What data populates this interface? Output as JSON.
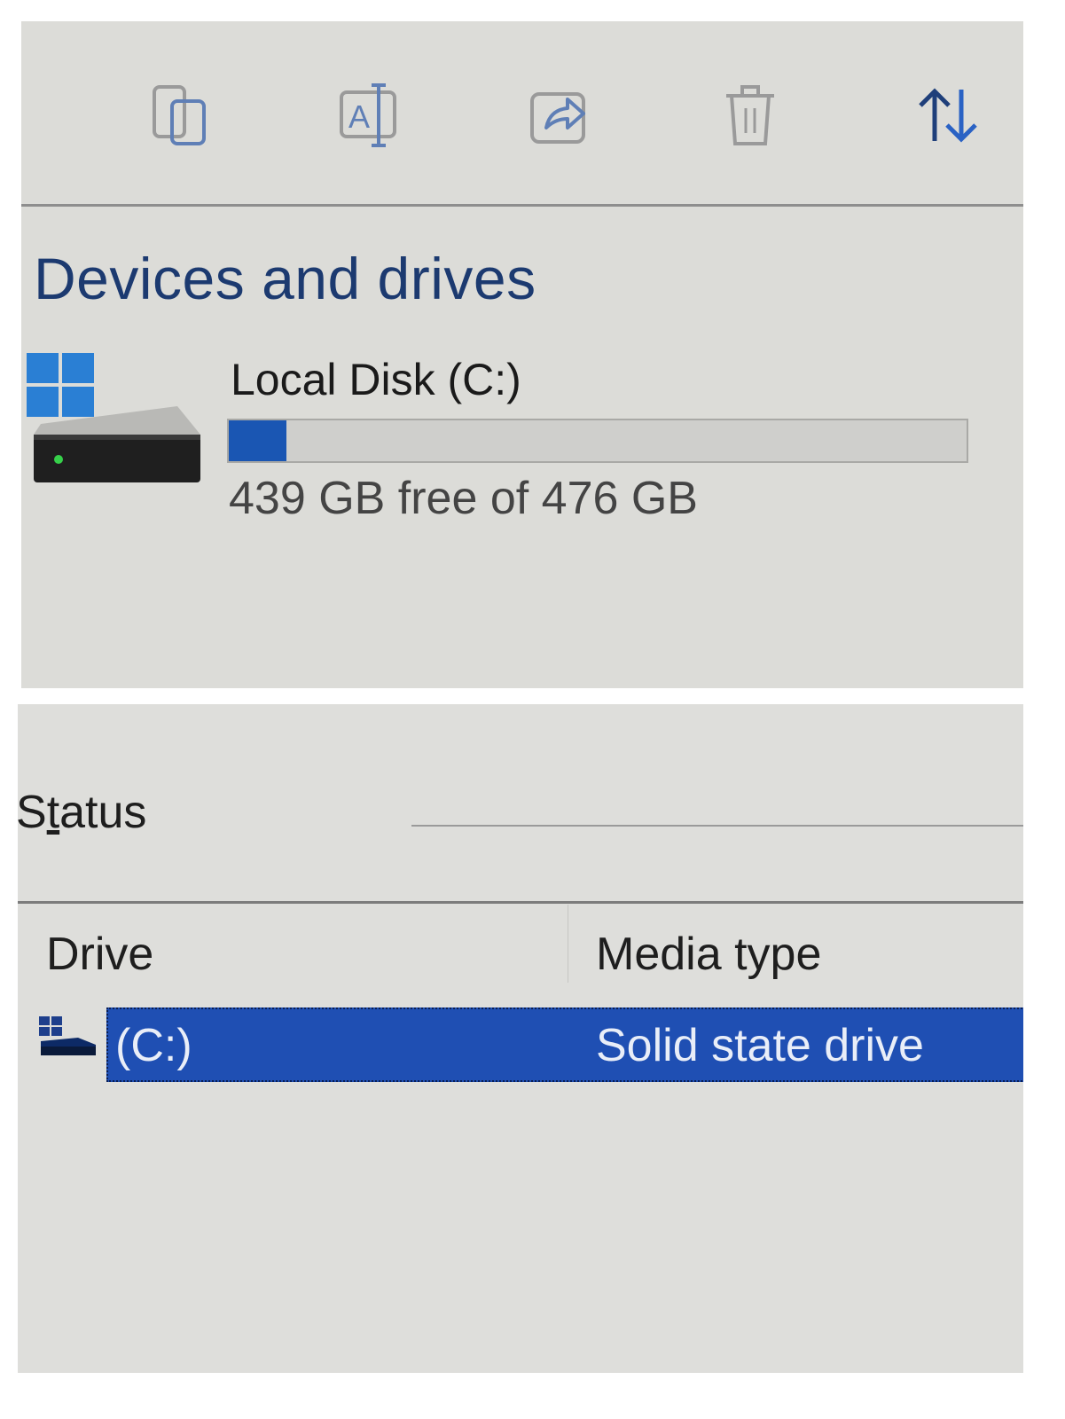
{
  "toolbar": {
    "buttons": [
      {
        "name": "copy",
        "icon": "copy-icon"
      },
      {
        "name": "rename",
        "icon": "rename-icon"
      },
      {
        "name": "share",
        "icon": "share-icon"
      },
      {
        "name": "delete",
        "icon": "trash-icon"
      },
      {
        "name": "sort",
        "icon": "sort-icon"
      }
    ]
  },
  "devices": {
    "section_title": "Devices and drives",
    "drive": {
      "label": "Local Disk (C:)",
      "icon": "windows-drive-icon",
      "capacity_text": "439 GB free of 476 GB",
      "used_fraction": 0.078
    }
  },
  "optimize": {
    "status_label": "Status",
    "columns": {
      "drive": "Drive",
      "media_type": "Media type"
    },
    "rows": [
      {
        "drive": "(C:)",
        "media_type": "Solid state drive",
        "icon": "drive-icon",
        "selected": true
      }
    ]
  },
  "colors": {
    "accent_blue": "#1a56b3",
    "selection_blue": "#1f4fb3",
    "title_blue": "#1c3a70"
  }
}
